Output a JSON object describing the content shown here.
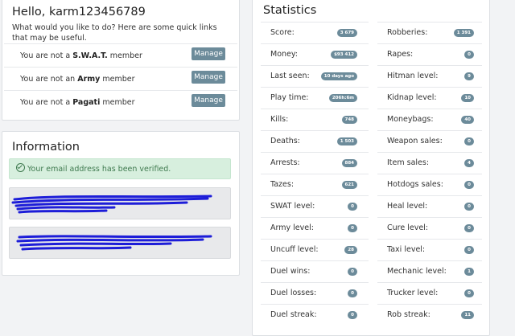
{
  "welcome": {
    "greeting": "Hello, karm123456789",
    "subtitle": "What would you like to do? Here are some quick links that may be useful.",
    "memberships": [
      {
        "prefix": "You are not a ",
        "group": "S.W.A.T.",
        "suffix": " member",
        "button": "Manage"
      },
      {
        "prefix": "You are not an ",
        "group": "Army",
        "suffix": " member",
        "button": "Manage"
      },
      {
        "prefix": "You are not a ",
        "group": "Pagati",
        "suffix": " member",
        "button": "Manage"
      }
    ]
  },
  "information": {
    "title": "Information",
    "verified_message": "Your email address has been verified.",
    "scribble_color": "#1d1dd8"
  },
  "statistics": {
    "title": "Statistics",
    "left": [
      {
        "label": "Score:",
        "value": "3 679"
      },
      {
        "label": "Money:",
        "value": "$93 412"
      },
      {
        "label": "Last seen:",
        "value": "10 days ago"
      },
      {
        "label": "Play time:",
        "value": "206h:6m"
      },
      {
        "label": "Kills:",
        "value": "748"
      },
      {
        "label": "Deaths:",
        "value": "1 503"
      },
      {
        "label": "Arrests:",
        "value": "884"
      },
      {
        "label": "Tazes:",
        "value": "621"
      },
      {
        "label": "SWAT level:",
        "value": "0"
      },
      {
        "label": "Army level:",
        "value": "0"
      },
      {
        "label": "Uncuff level:",
        "value": "28"
      },
      {
        "label": "Duel wins:",
        "value": "0"
      },
      {
        "label": "Duel losses:",
        "value": "0"
      },
      {
        "label": "Duel streak:",
        "value": "0"
      }
    ],
    "right": [
      {
        "label": "Robberies:",
        "value": "1 391"
      },
      {
        "label": "Rapes:",
        "value": "0"
      },
      {
        "label": "Hitman level:",
        "value": "9"
      },
      {
        "label": "Kidnap level:",
        "value": "10"
      },
      {
        "label": "Moneybags:",
        "value": "40"
      },
      {
        "label": "Weapon sales:",
        "value": "0"
      },
      {
        "label": "Item sales:",
        "value": "4"
      },
      {
        "label": "Hotdogs sales:",
        "value": "0"
      },
      {
        "label": "Heal level:",
        "value": "0"
      },
      {
        "label": "Cure level:",
        "value": "0"
      },
      {
        "label": "Taxi level:",
        "value": "0"
      },
      {
        "label": "Mechanic level:",
        "value": "1"
      },
      {
        "label": "Trucker level:",
        "value": "0"
      },
      {
        "label": "Rob streak:",
        "value": "11"
      }
    ]
  },
  "colors": {
    "badge": "#6c8b9a",
    "button": "#6c8b9a",
    "success_bg": "#d7efde",
    "success_text": "#3f7a4f"
  }
}
